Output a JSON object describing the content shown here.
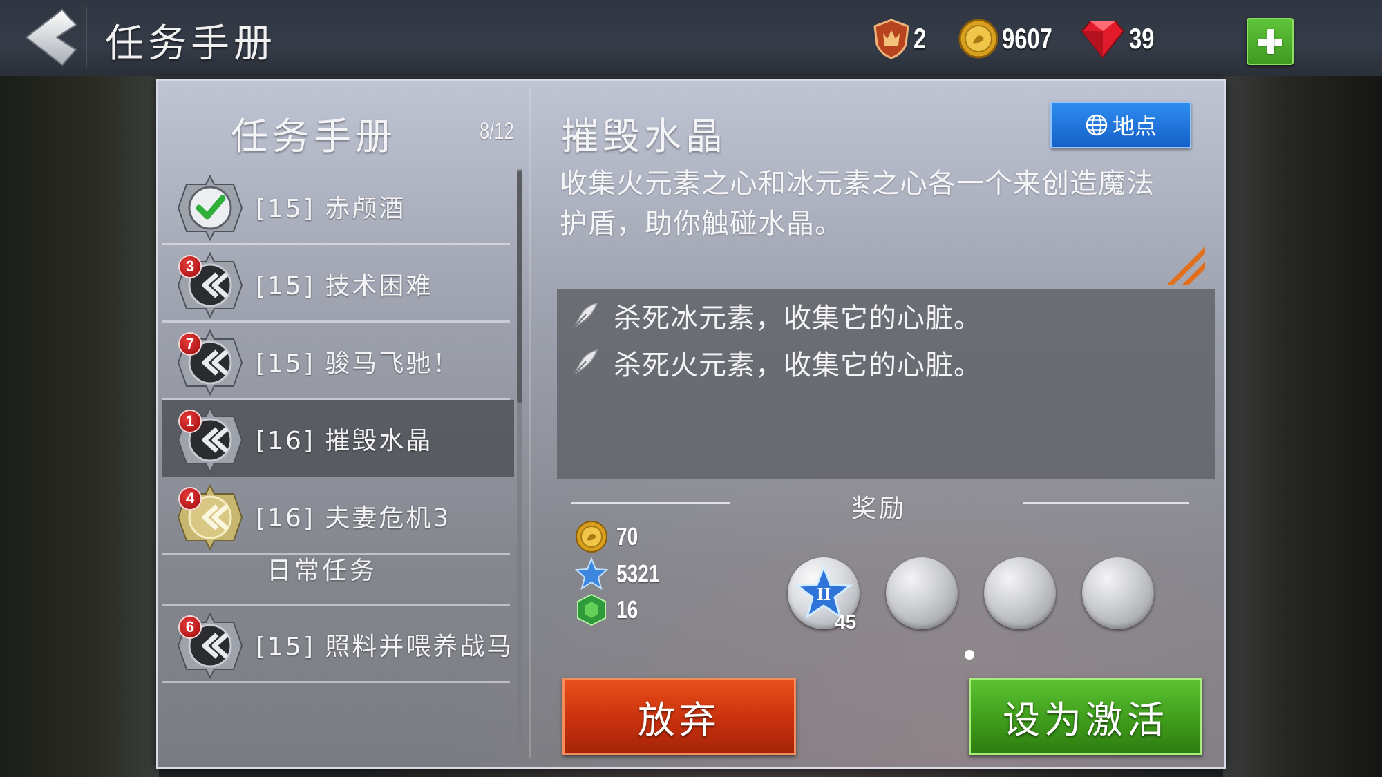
{
  "header": {
    "title": "任务手册",
    "currencies": {
      "trophy": "2",
      "gold": "9607",
      "gems": "39"
    }
  },
  "quest_list": {
    "title": "任务手册",
    "count": "8/12",
    "items": [
      {
        "label": "[15] 赤颅酒",
        "badge": "",
        "status": "completed"
      },
      {
        "label": "[15] 技术困难",
        "badge": "3",
        "status": "active"
      },
      {
        "label": "[15] 骏马飞驰！",
        "badge": "7",
        "status": "active"
      },
      {
        "label": "[16] 摧毁水晶",
        "badge": "1",
        "status": "selected"
      },
      {
        "label": "[16] 夫妻危机3",
        "badge": "4",
        "status": "gold"
      }
    ],
    "daily_header": "日常任务",
    "daily_items": [
      {
        "label": "[15] 照料并喂养战马",
        "badge": "6",
        "status": "active"
      }
    ]
  },
  "detail": {
    "title": "摧毁水晶",
    "location_label": "地点",
    "description": "收集火元素之心和冰元素之心各一个来创造魔法护盾，助你触碰水晶。",
    "objectives": [
      "杀死冰元素，收集它的心脏。",
      "杀死火元素，收集它的心脏。"
    ],
    "rewards": {
      "title": "奖励",
      "gold": "70",
      "xp": "5321",
      "honor": "16",
      "item_level": "45"
    },
    "abandon_label": "放弃",
    "activate_label": "设为激活"
  },
  "colors": {
    "accent_blue": "#1f7ae0",
    "abandon_red": "#c9310d",
    "activate_green": "#3f9d1c",
    "badge_red": "#c41616"
  }
}
